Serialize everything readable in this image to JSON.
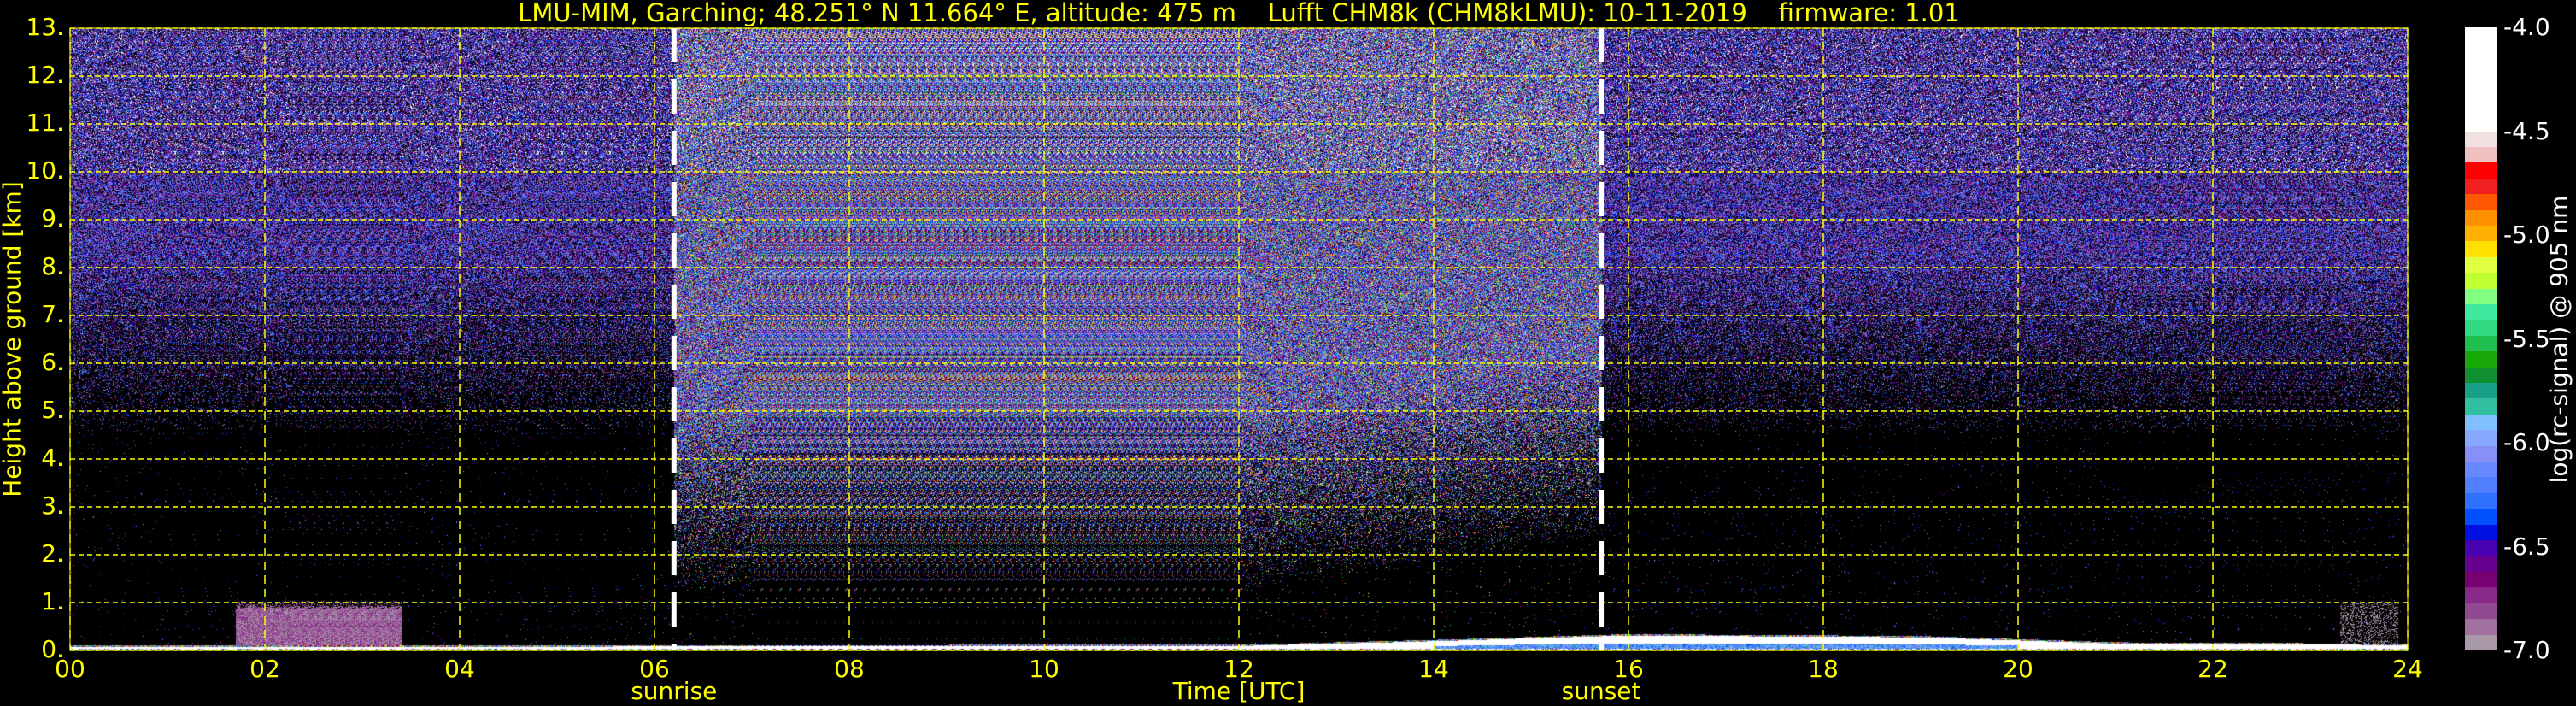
{
  "title": "LMU-MIM, Garching; 48.251° N 11.664° E, altitude: 475 m    Lufft CHM8k (CHM8kLMU): 10-11-2019    firmware: 1.01",
  "chart_data": {
    "type": "heatmap",
    "title": "LMU-MIM, Garching; 48.251° N 11.664° E, altitude: 475 m    Lufft CHM8k (CHM8kLMU): 10-11-2019    firmware: 1.01",
    "xlabel": "Time [UTC]",
    "ylabel": "Height above ground [km]",
    "xlim": [
      0,
      24
    ],
    "ylim": [
      0,
      13
    ],
    "xticks": [
      "00",
      "02",
      "04",
      "06",
      "08",
      "10",
      "12",
      "14",
      "16",
      "18",
      "20",
      "22",
      "24"
    ],
    "xtick_values": [
      0,
      2,
      4,
      6,
      8,
      10,
      12,
      14,
      16,
      18,
      20,
      22,
      24
    ],
    "yticks": [
      "0.",
      "1.",
      "2.",
      "3.",
      "4.",
      "5.",
      "6.",
      "7.",
      "8.",
      "9.",
      "10.",
      "11.",
      "12.",
      "13."
    ],
    "ytick_values": [
      0,
      1,
      2,
      3,
      4,
      5,
      6,
      7,
      8,
      9,
      10,
      11,
      12,
      13
    ],
    "grid": true,
    "grid_color": "#ffff00",
    "events": [
      {
        "label": "sunrise",
        "time": 6.2
      },
      {
        "label": "sunset",
        "time": 15.72
      }
    ],
    "colorbar": {
      "label": "log(rc-signal) @ 905 nm",
      "range": [
        -7.0,
        -4.0
      ],
      "ticks": [
        "-4.0",
        "-4.5",
        "-5.0",
        "-5.5",
        "-6.0",
        "-6.5",
        "-7.0"
      ],
      "tick_values": [
        -4.0,
        -4.5,
        -5.0,
        -5.5,
        -6.0,
        -6.5,
        -7.0
      ],
      "colors_bottom_to_top": [
        "#a898a8",
        "#a070a0",
        "#904890",
        "#882888",
        "#780070",
        "#680090",
        "#4800b0",
        "#0010e0",
        "#0050ff",
        "#3070ff",
        "#5080ff",
        "#6888ff",
        "#8890f8",
        "#88a8ff",
        "#80c0ff",
        "#30c0a0",
        "#18a088",
        "#109030",
        "#18a808",
        "#20c050",
        "#30d880",
        "#40e8a0",
        "#80ff80",
        "#c0ff30",
        "#e0ff40",
        "#ffe000",
        "#ffb000",
        "#ff9000",
        "#ff5800",
        "#f02020",
        "#ff0000",
        "#f0c0c0",
        "#f0e0e0"
      ],
      "top_color": "#ffffff"
    },
    "features": {
      "noise_onset_height_km": {
        "night": 4.5,
        "day": 1.2
      },
      "boundary_layer_top_km": [
        [
          0,
          0.08
        ],
        [
          12,
          0.1
        ],
        [
          14,
          0.2
        ],
        [
          16,
          0.32
        ],
        [
          19,
          0.28
        ],
        [
          21,
          0.15
        ],
        [
          24,
          0.12
        ]
      ],
      "aerosol_layer": {
        "start": 1.7,
        "end": 3.4,
        "top_km": 1.0,
        "value": -6.6
      },
      "late_aerosol": {
        "start": 23.3,
        "end": 23.9,
        "top_km": 1.0,
        "value": -6.9
      }
    }
  }
}
